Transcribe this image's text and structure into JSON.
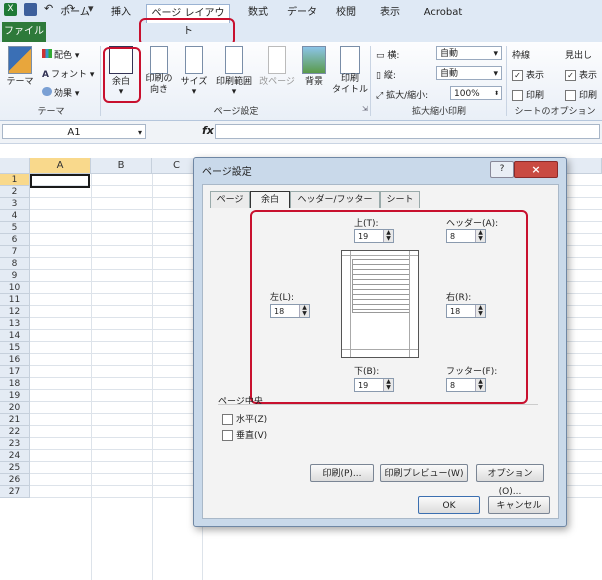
{
  "tabs": {
    "file": "ファイル",
    "home": "ホーム",
    "insert": "挿入",
    "page_layout": "ページ レイアウト",
    "formulas": "数式",
    "data": "データ",
    "review": "校閲",
    "view": "表示",
    "acrobat": "Acrobat"
  },
  "ribbon": {
    "theme": "テーマ",
    "colors": "配色",
    "fonts": "フォント",
    "effects": "効果",
    "theme_group": "テーマ",
    "margins": "余白",
    "orientation": "印刷の\n向き",
    "size": "サイズ",
    "print_area": "印刷範囲",
    "breaks": "改ページ",
    "background": "背景",
    "print_titles": "印刷\nタイトル",
    "page_setup_group": "ページ設定",
    "width_label": "横:",
    "width_value": "自動",
    "height_label": "縦:",
    "height_value": "自動",
    "scale_label": "拡大/縮小:",
    "scale_value": "100%",
    "scale_group": "拡大縮小印刷",
    "gridlines": "枠線",
    "headings": "見出し",
    "view1": "表示",
    "print1": "印刷",
    "view2": "表示",
    "print2": "印刷",
    "sheet_options_group": "シートのオプション"
  },
  "formula_bar": {
    "name_box": "A1",
    "fx": "fx"
  },
  "sheet": {
    "columns": [
      "A",
      "B",
      "C"
    ],
    "rows": [
      "1",
      "2",
      "3",
      "4",
      "5",
      "6",
      "7",
      "8",
      "9",
      "10",
      "11",
      "12",
      "13",
      "14",
      "15",
      "16",
      "17",
      "18",
      "19",
      "20",
      "21",
      "22",
      "23",
      "24",
      "25",
      "26",
      "27"
    ]
  },
  "dialog": {
    "title": "ページ設定",
    "help": "?",
    "close": "×",
    "tabs": [
      "ページ",
      "余白",
      "ヘッダー/フッター",
      "シート"
    ],
    "top_label": "上(T):",
    "top_value": "19",
    "header_label": "ヘッダー(A):",
    "header_value": "8",
    "left_label": "左(L):",
    "left_value": "18",
    "right_label": "右(R):",
    "right_value": "18",
    "bottom_label": "下(B):",
    "bottom_value": "19",
    "footer_label": "フッター(F):",
    "footer_value": "8",
    "center_label": "ページ中央",
    "horizontal": "水平(Z)",
    "vertical": "垂直(V)",
    "print_btn": "印刷(P)...",
    "preview_btn": "印刷プレビュー(W)",
    "options_btn": "オプション(O)...",
    "ok": "OK",
    "cancel": "キャンセル"
  },
  "colors": {
    "accent_red": "#c8102e",
    "file_green": "#2e7a3a"
  }
}
